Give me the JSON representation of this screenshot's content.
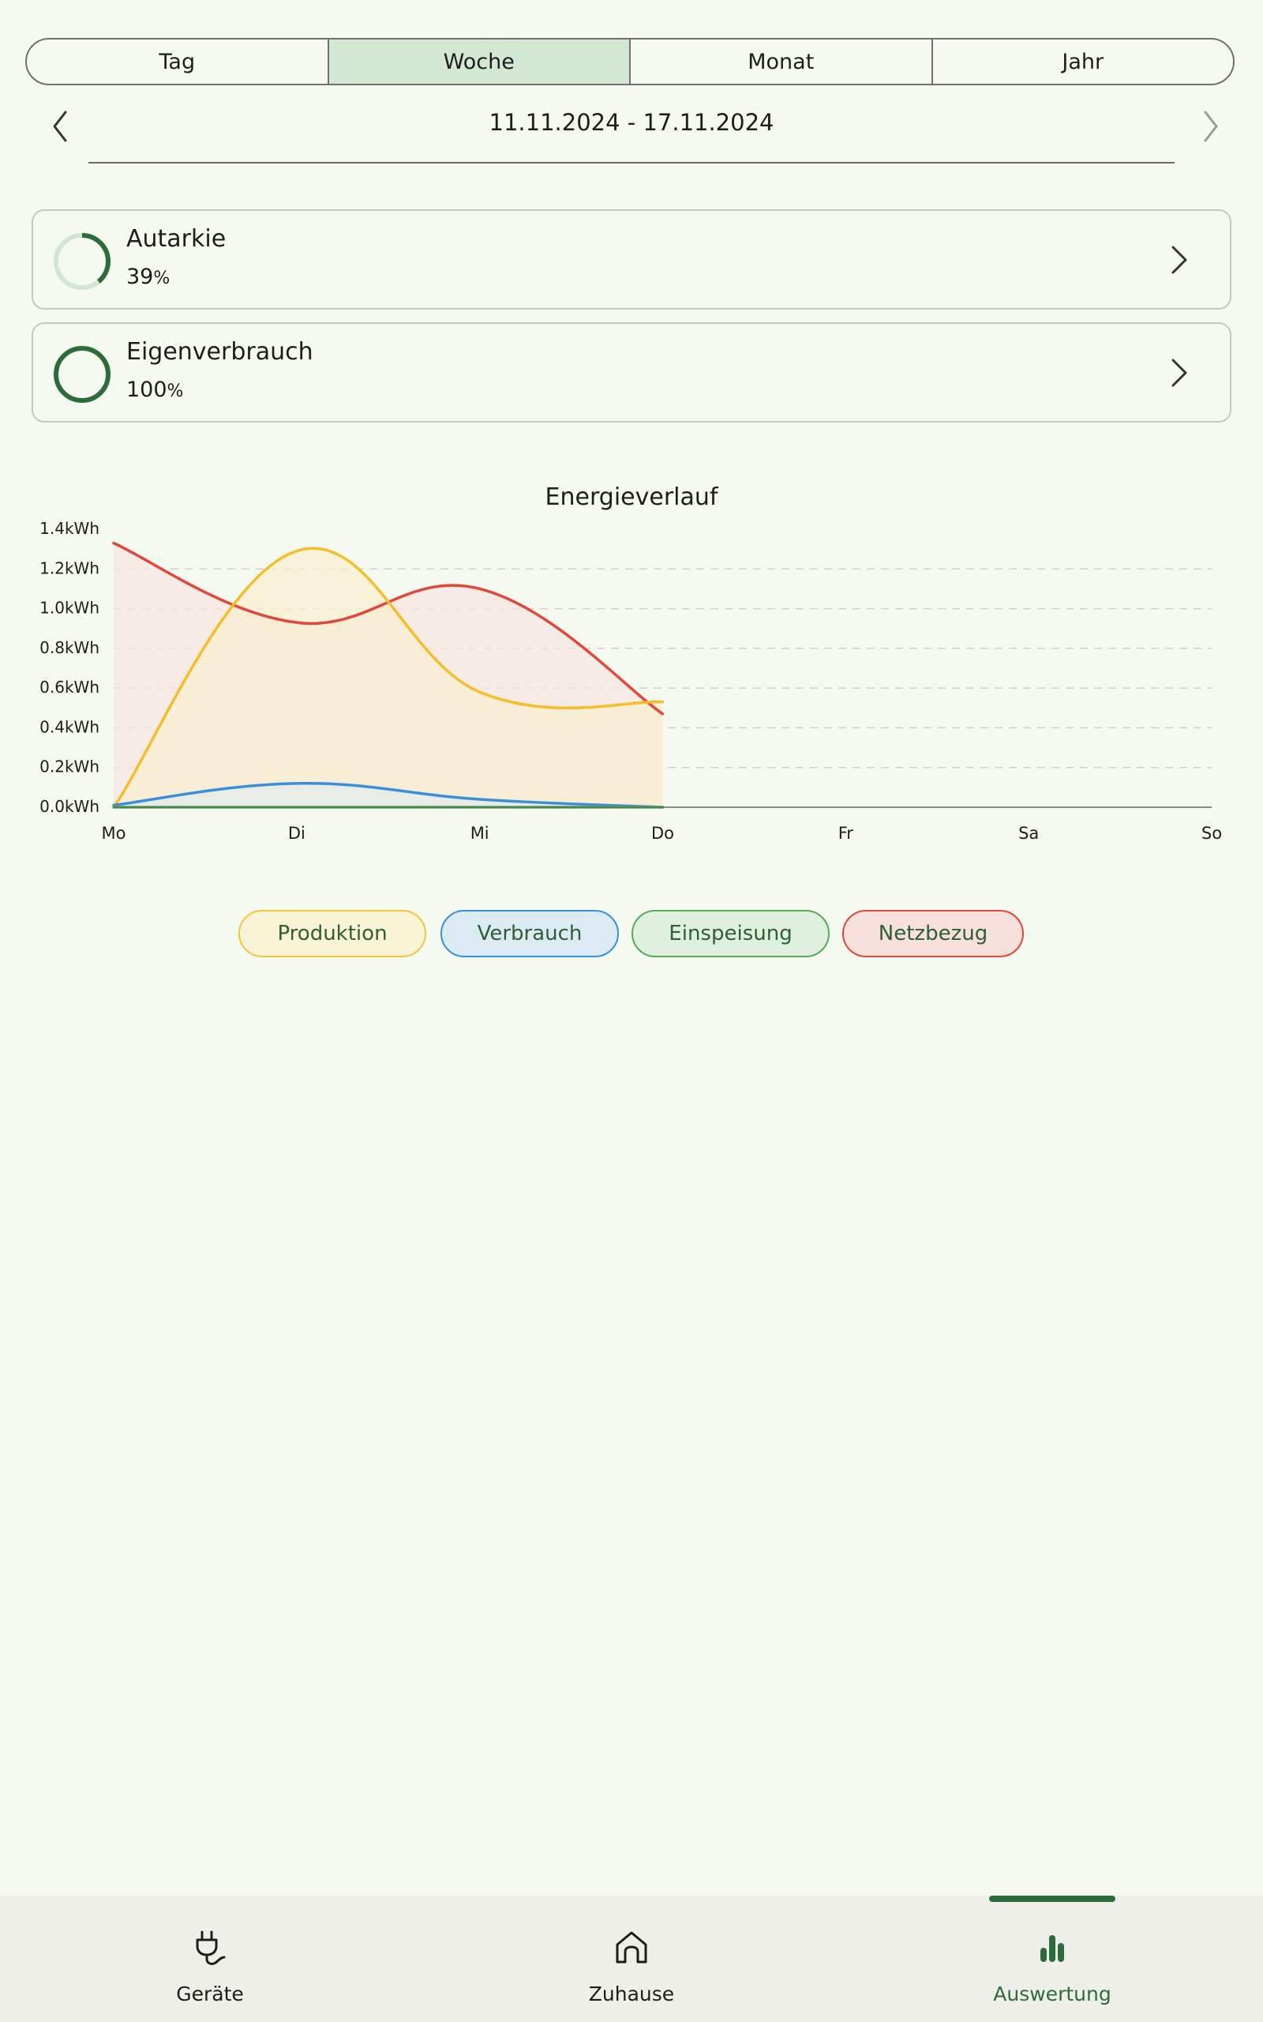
{
  "tabs": [
    {
      "label": "Tag",
      "active": false
    },
    {
      "label": "Woche",
      "active": true
    },
    {
      "label": "Monat",
      "active": false
    },
    {
      "label": "Jahr",
      "active": false
    }
  ],
  "date_range": "11.11.2024 - 17.11.2024",
  "cards": [
    {
      "title": "Autarkie",
      "value": "39",
      "unit": "%",
      "fraction": 0.39
    },
    {
      "title": "Eigenverbrauch",
      "value": "100",
      "unit": "%",
      "fraction": 1.0
    }
  ],
  "chart_data": {
    "type": "area",
    "title": "Energieverlauf",
    "categories": [
      "Mo",
      "Di",
      "Mi",
      "Do",
      "Fr",
      "Sa",
      "So"
    ],
    "y_ticks": [
      "0.0kWh",
      "0.2kWh",
      "0.4kWh",
      "0.6kWh",
      "0.8kWh",
      "1.0kWh",
      "1.2kWh",
      "1.4kWh"
    ],
    "ylim": [
      0,
      1.4
    ],
    "grid": true,
    "series": [
      {
        "name": "Netzbezug",
        "color": "#e3463a",
        "fill": "#f7e6e2",
        "values": [
          1.33,
          0.93,
          1.1,
          0.47
        ]
      },
      {
        "name": "Produktion",
        "color": "#f6bd29",
        "fill": "#f8efd0",
        "values": [
          0.0,
          1.29,
          0.58,
          0.53
        ]
      },
      {
        "name": "Verbrauch",
        "color": "#3b8ed8",
        "fill": "#e1ebec",
        "values": [
          0.01,
          0.12,
          0.04,
          0.0
        ]
      },
      {
        "name": "Einspeisung",
        "color": "#4caf50",
        "fill": "#e3f2e3",
        "values": [
          0.0,
          0.0,
          0.0,
          0.0
        ]
      }
    ]
  },
  "legend": [
    {
      "label": "Produktion",
      "border": "#f3c53e",
      "bg": "#faf4d6"
    },
    {
      "label": "Verbrauch",
      "border": "#3b8ed8",
      "bg": "#dcebf3"
    },
    {
      "label": "Einspeisung",
      "border": "#5aa85a",
      "bg": "#e0f0df"
    },
    {
      "label": "Netzbezug",
      "border": "#e3463a",
      "bg": "#f7e0dc"
    }
  ],
  "bottom_nav": [
    {
      "label": "Geräte",
      "icon": "plug-icon",
      "active": false
    },
    {
      "label": "Zuhause",
      "icon": "home-icon",
      "active": false
    },
    {
      "label": "Auswertung",
      "icon": "bar-chart-icon",
      "active": true
    }
  ],
  "colors": {
    "accent": "#2e6b3a",
    "background": "#f5faf0",
    "ring_track": "#d3e6d3"
  }
}
